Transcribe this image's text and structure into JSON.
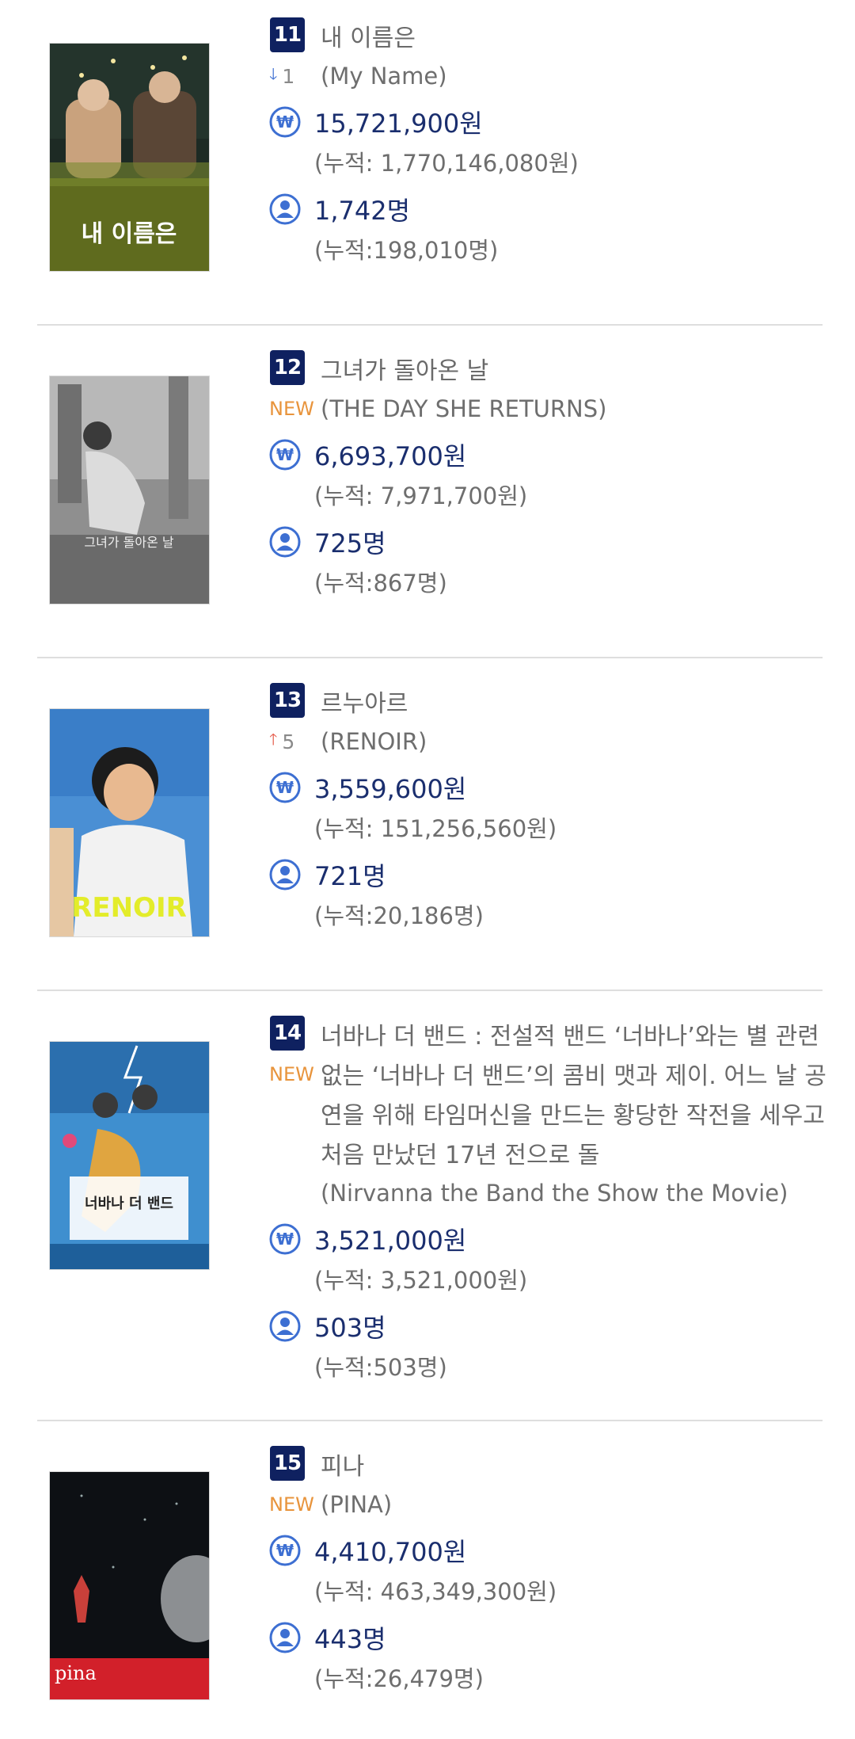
{
  "entries": [
    {
      "rank": "11",
      "title": "내 이름은",
      "change_type": "down",
      "change_value": "1",
      "original_title": "(My Name)",
      "revenue": "15,721,900원",
      "revenue_total": "(누적: 1,770,146,080원)",
      "audience": "1,742명",
      "audience_total": "(누적:198,010명)",
      "poster_text": "내 이름은"
    },
    {
      "rank": "12",
      "title": "그녀가 돌아온 날",
      "change_type": "new",
      "change_value": "NEW",
      "original_title": "(THE DAY SHE RETURNS)",
      "revenue": "6,693,700원",
      "revenue_total": "(누적: 7,971,700원)",
      "audience": "725명",
      "audience_total": "(누적:867명)",
      "poster_text": "그녀가 돌아온 날"
    },
    {
      "rank": "13",
      "title": "르누아르",
      "change_type": "up",
      "change_value": "5",
      "original_title": "(RENOIR)",
      "revenue": "3,559,600원",
      "revenue_total": "(누적: 151,256,560원)",
      "audience": "721명",
      "audience_total": "(누적:20,186명)",
      "poster_text": "RENOIR"
    },
    {
      "rank": "14",
      "title": "너바나 더 밴드 : 전설적 밴드 ‘너바나’와는 별 관련 없는 ‘너바나 더 밴드’의 콤비 맷과 제이. 어느 날 공연을 위해 타임머신을 만드는 황당한 작전을 세우고 처음 만났던 17년 전으로 돌",
      "change_type": "new",
      "change_value": "NEW",
      "original_title": "(Nirvanna the Band the Show the Movie)",
      "revenue": "3,521,000원",
      "revenue_total": "(누적: 3,521,000원)",
      "audience": "503명",
      "audience_total": "(누적:503명)",
      "poster_text": "너바나 더 밴드"
    },
    {
      "rank": "15",
      "title": "피나",
      "change_type": "new",
      "change_value": "NEW",
      "original_title": "(PINA)",
      "revenue": "4,410,700원",
      "revenue_total": "(누적: 463,349,300원)",
      "audience": "443명",
      "audience_total": "(누적:26,479명)",
      "poster_text": "pina"
    }
  ],
  "colors": {
    "rank_badge": "#0f2160",
    "value_text": "#1a2e6e",
    "icon_blue": "#3d6fd2",
    "new_orange": "#e8943c",
    "up_red": "#e55a4a"
  },
  "icons": {
    "revenue": "won-circle-icon",
    "audience": "person-circle-icon"
  }
}
